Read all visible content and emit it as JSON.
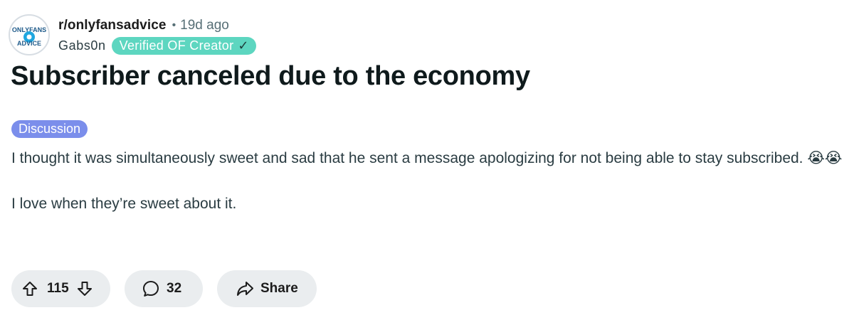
{
  "post": {
    "subreddit": "r/onlyfansadvice",
    "separator": "•",
    "age": "19d ago",
    "author": "Gabs0n",
    "author_flair": "Verified OF Creator",
    "author_flair_check": "✓",
    "avatar_text_top": "ONLYFANS",
    "avatar_text_bottom": "ADVICE",
    "title": "Subscriber canceled due to the economy",
    "post_flair": "Discussion",
    "body_paragraph_1": "I thought it was simultaneously sweet and sad that he sent a message apologizing for not being able to stay subscribed.",
    "body_emoji": "😭😭",
    "body_paragraph_2": "I love when they’re sweet about it."
  },
  "actions": {
    "upvote_icon": "upvote-arrow-icon",
    "vote_count": "115",
    "downvote_icon": "downvote-arrow-icon",
    "comment_icon": "comment-bubble-icon",
    "comment_count": "32",
    "share_icon": "share-arrow-icon",
    "share_label": "Share"
  },
  "colors": {
    "author_flair_bg": "#5dd6c0",
    "post_flair_bg": "#7b8eeb",
    "action_pill_bg": "#eaedef",
    "avatar_brand": "#1fa7e0"
  }
}
